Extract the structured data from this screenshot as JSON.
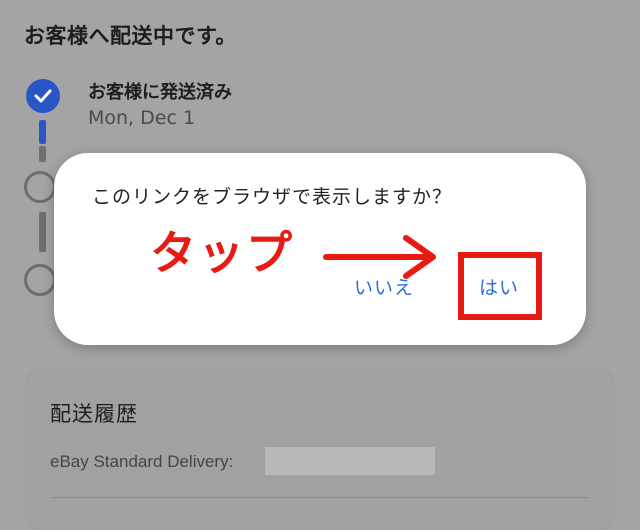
{
  "page": {
    "title": "お客様へ配送中です。"
  },
  "timeline": {
    "steps": [
      {
        "title": "お客様に発送済み",
        "date": "Mon, Dec 1"
      }
    ]
  },
  "dialog": {
    "message": "このリンクをブラウザで表示しますか？",
    "no_label": "いいえ",
    "yes_label": "はい"
  },
  "annotation": {
    "tap_text": "タップ"
  },
  "history": {
    "title": "配送履歴",
    "delivery_label": "eBay Standard Delivery:"
  },
  "colors": {
    "accent": "#2a55c6",
    "link": "#2f6fd6",
    "annotation_red": "#e81a14",
    "overlay_gray": "#a4a4a4"
  },
  "icons": [
    "check-icon"
  ]
}
